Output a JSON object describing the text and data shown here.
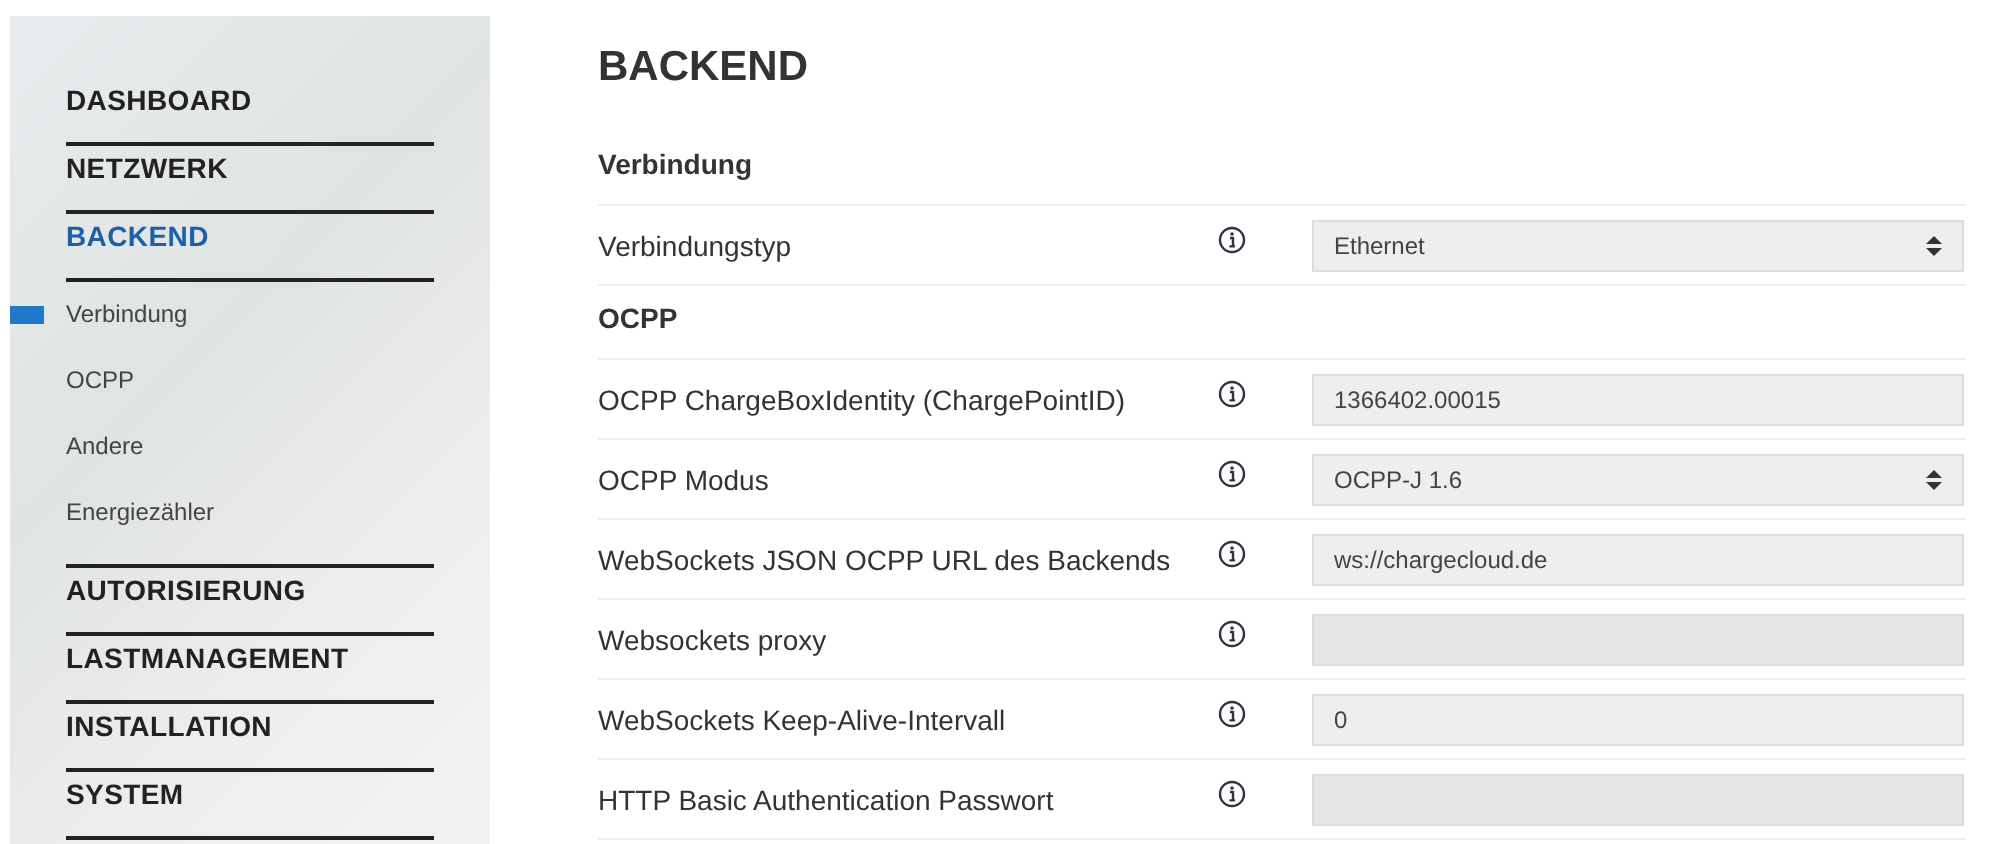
{
  "sidebar": {
    "items": [
      {
        "label": "DASHBOARD",
        "selected": false
      },
      {
        "label": "NETZWERK",
        "selected": false
      },
      {
        "label": "BACKEND",
        "selected": true,
        "children": [
          {
            "label": "Verbindung",
            "selected": true
          },
          {
            "label": "OCPP",
            "selected": false
          },
          {
            "label": "Andere",
            "selected": false
          },
          {
            "label": "Energiezähler",
            "selected": false
          }
        ]
      },
      {
        "label": "AUTORISIERUNG",
        "selected": false
      },
      {
        "label": "LASTMANAGEMENT",
        "selected": false
      },
      {
        "label": "INSTALLATION",
        "selected": false
      },
      {
        "label": "SYSTEM",
        "selected": false
      }
    ]
  },
  "page": {
    "title": "BACKEND",
    "sections": [
      {
        "title": "Verbindung",
        "rows": [
          {
            "label": "Verbindungstyp",
            "kind": "select",
            "value": "Ethernet"
          }
        ]
      },
      {
        "title": "OCPP",
        "rows": [
          {
            "label": "OCPP ChargeBoxIdentity (ChargePointID)",
            "kind": "input",
            "value": "1366402.00015"
          },
          {
            "label": "OCPP Modus",
            "kind": "select",
            "value": "OCPP-J 1.6"
          },
          {
            "label": "WebSockets JSON OCPP URL des Backends",
            "kind": "input",
            "value": "ws://chargecloud.de"
          },
          {
            "label": "Websockets proxy",
            "kind": "input"
          },
          {
            "label": "WebSockets Keep-Alive-Intervall",
            "kind": "input",
            "value": "0"
          },
          {
            "label": "HTTP Basic Authentication Passwort",
            "kind": "input"
          }
        ]
      }
    ]
  }
}
